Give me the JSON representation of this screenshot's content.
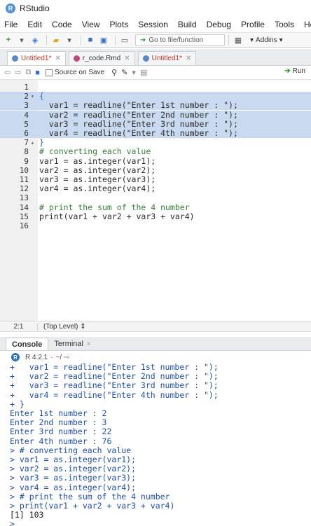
{
  "window": {
    "title": "RStudio",
    "logo_letter": "R"
  },
  "menu": [
    "File",
    "Edit",
    "Code",
    "View",
    "Plots",
    "Session",
    "Build",
    "Debug",
    "Profile",
    "Tools",
    "Help"
  ],
  "toolbar": {
    "goto_placeholder": "Go to file/function",
    "addins_label": "Addins"
  },
  "editor_tabs": [
    {
      "label": "Untitled1*",
      "active": true
    },
    {
      "label": "r_code.Rmd",
      "active": false
    },
    {
      "label": "Untitled1*",
      "active": false
    }
  ],
  "editor_toolbar": {
    "source_on_save": "Source on Save",
    "run_label": "Run"
  },
  "code_lines": [
    {
      "n": "1",
      "text": "",
      "fold": "",
      "selected": false,
      "kind": "code"
    },
    {
      "n": "2",
      "text": "{",
      "fold": "▾",
      "selected": true,
      "kind": "brace"
    },
    {
      "n": "3",
      "text": "  var1 = readline(\"Enter 1st number : \");",
      "fold": "",
      "selected": true,
      "kind": "code"
    },
    {
      "n": "4",
      "text": "  var2 = readline(\"Enter 2nd number : \");",
      "fold": "",
      "selected": true,
      "kind": "code"
    },
    {
      "n": "5",
      "text": "  var3 = readline(\"Enter 3rd number : \");",
      "fold": "",
      "selected": true,
      "kind": "code"
    },
    {
      "n": "6",
      "text": "  var4 = readline(\"Enter 4th number : \");",
      "fold": "",
      "selected": true,
      "kind": "code"
    },
    {
      "n": "7",
      "text": "}",
      "fold": "▴",
      "selected": false,
      "kind": "brace"
    },
    {
      "n": "8",
      "text": "# converting each value",
      "fold": "",
      "selected": false,
      "kind": "comment"
    },
    {
      "n": "9",
      "text": "var1 = as.integer(var1);",
      "fold": "",
      "selected": false,
      "kind": "code"
    },
    {
      "n": "10",
      "text": "var2 = as.integer(var2);",
      "fold": "",
      "selected": false,
      "kind": "code"
    },
    {
      "n": "11",
      "text": "var3 = as.integer(var3);",
      "fold": "",
      "selected": false,
      "kind": "code"
    },
    {
      "n": "12",
      "text": "var4 = as.integer(var4);",
      "fold": "",
      "selected": false,
      "kind": "code"
    },
    {
      "n": "13",
      "text": "",
      "fold": "",
      "selected": false,
      "kind": "code"
    },
    {
      "n": "14",
      "text": "# print the sum of the 4 number",
      "fold": "",
      "selected": false,
      "kind": "comment"
    },
    {
      "n": "15",
      "text": "print(var1 + var2 + var3 + var4)",
      "fold": "",
      "selected": false,
      "kind": "code"
    },
    {
      "n": "16",
      "text": "",
      "fold": "",
      "selected": false,
      "kind": "code"
    }
  ],
  "status": {
    "cursor": "2:1",
    "scope": "(Top Level)"
  },
  "console_tabs": [
    {
      "label": "Console",
      "active": true
    },
    {
      "label": "Terminal",
      "active": false
    }
  ],
  "console_info": {
    "version": "R 4.2.1",
    "path": "~/"
  },
  "console_lines": [
    {
      "text": "+   var1 = readline(\"Enter 1st number : \");",
      "kind": "in"
    },
    {
      "text": "+   var2 = readline(\"Enter 2nd number : \");",
      "kind": "in"
    },
    {
      "text": "+   var3 = readline(\"Enter 3rd number : \");",
      "kind": "in"
    },
    {
      "text": "+   var4 = readline(\"Enter 4th number : \");",
      "kind": "in"
    },
    {
      "text": "+ }",
      "kind": "in"
    },
    {
      "text": "Enter 1st number : 2",
      "kind": "in"
    },
    {
      "text": "Enter 2nd number : 3",
      "kind": "in"
    },
    {
      "text": "Enter 3rd number : 22",
      "kind": "in"
    },
    {
      "text": "Enter 4th number : 76",
      "kind": "in"
    },
    {
      "text": "> # converting each value",
      "kind": "in"
    },
    {
      "text": "> var1 = as.integer(var1);",
      "kind": "in"
    },
    {
      "text": "> var2 = as.integer(var2);",
      "kind": "in"
    },
    {
      "text": "> var3 = as.integer(var3);",
      "kind": "in"
    },
    {
      "text": "> var4 = as.integer(var4);",
      "kind": "in"
    },
    {
      "text": "> # print the sum of the 4 number",
      "kind": "in"
    },
    {
      "text": "> print(var1 + var2 + var3 + var4)",
      "kind": "in"
    },
    {
      "text": "[1] 103",
      "kind": "out"
    },
    {
      "text": ">",
      "kind": "in"
    }
  ]
}
